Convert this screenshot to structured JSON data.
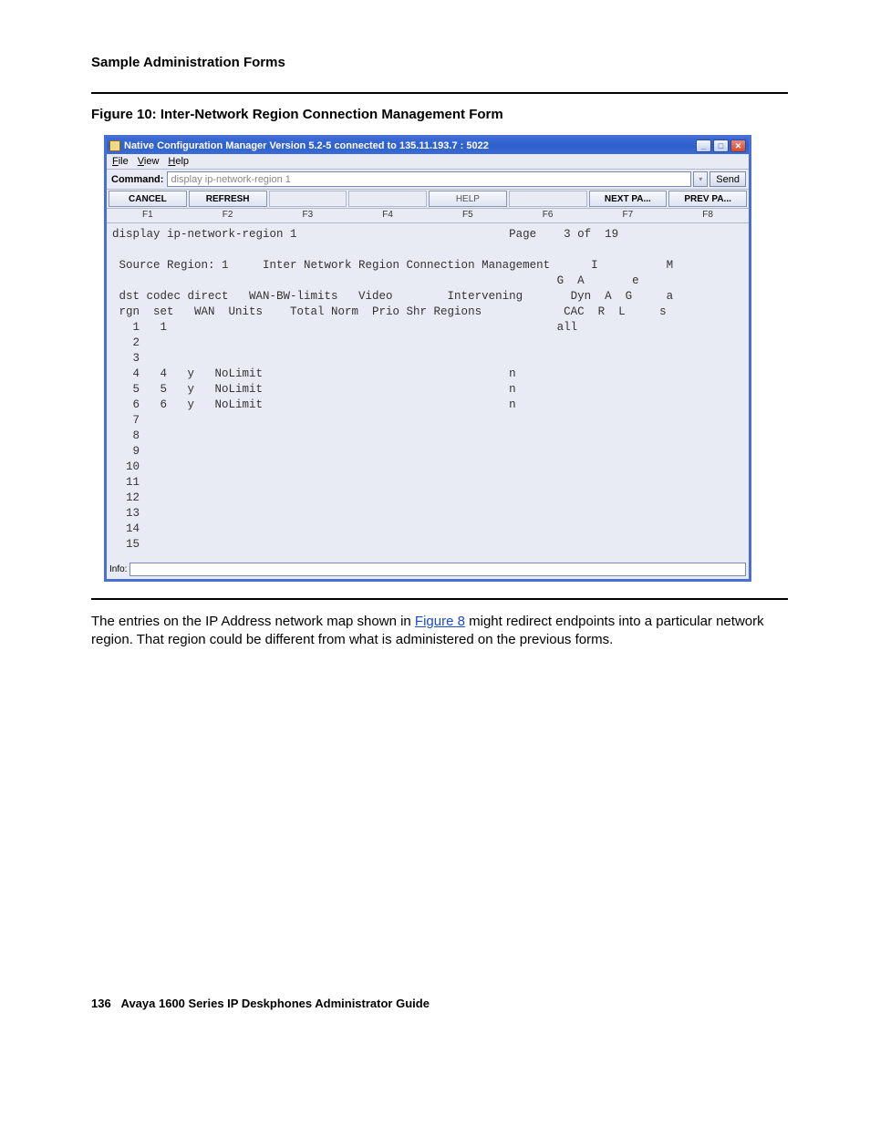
{
  "doc": {
    "section_title": "Sample Administration Forms",
    "figure_caption": "Figure 10: Inter-Network Region Connection Management Form",
    "body_text_pre": "The entries on the IP Address network map shown in ",
    "figure_link": "Figure 8",
    "body_text_post": " might redirect endpoints into a particular network region. That region could be different from what is administered on the previous forms.",
    "footer_page": "136",
    "footer_title": "Avaya 1600 Series IP Deskphones Administrator Guide"
  },
  "window": {
    "title": "Native Configuration Manager Version 5.2-5 connected to 135.11.193.7 : 5022",
    "menus": {
      "file": "File",
      "view": "View",
      "help": "Help"
    },
    "command_label": "Command:",
    "command_value": "display ip-network-region 1",
    "send_label": "Send",
    "buttons": {
      "cancel": "CANCEL",
      "refresh": "REFRESH",
      "help": "HELP",
      "next": "NEXT  PA...",
      "prev": "PREV  PA..."
    },
    "fkeys": {
      "f1": "F1",
      "f2": "F2",
      "f3": "F3",
      "f4": "F4",
      "f5": "F5",
      "f6": "F6",
      "f7": "F7",
      "f8": "F8"
    },
    "info_label": "Info:"
  },
  "terminal": {
    "cmdline": "display ip-network-region 1",
    "page_label": "Page",
    "page_current": "3",
    "page_of": "of",
    "page_total": "19",
    "source_region_label": "Source Region:",
    "source_region_value": "1",
    "form_title": "Inter Network Region Connection Management",
    "col_IG": "I\nG",
    "col_MA": "M\nA",
    "col_Me": "M\ne",
    "hdr1": "dst codec direct   WAN-BW-limits   Video        Intervening       Dyn  A  G     a",
    "hdr2": "rgn  set   WAN  Units    Total Norm  Prio Shr Regions            CAC  R  L     s",
    "rows": [
      {
        "rgn": "1",
        "set": "1",
        "wan": "",
        "units": "",
        "cac": "",
        "all": "all"
      },
      {
        "rgn": "2"
      },
      {
        "rgn": "3"
      },
      {
        "rgn": "4",
        "set": "4",
        "wan": "y",
        "units": "NoLimit",
        "cac": "n"
      },
      {
        "rgn": "5",
        "set": "5",
        "wan": "y",
        "units": "NoLimit",
        "cac": "n"
      },
      {
        "rgn": "6",
        "set": "6",
        "wan": "y",
        "units": "NoLimit",
        "cac": "n"
      },
      {
        "rgn": "7"
      },
      {
        "rgn": "8"
      },
      {
        "rgn": "9"
      },
      {
        "rgn": "10"
      },
      {
        "rgn": "11"
      },
      {
        "rgn": "12"
      },
      {
        "rgn": "13"
      },
      {
        "rgn": "14"
      },
      {
        "rgn": "15"
      }
    ]
  }
}
